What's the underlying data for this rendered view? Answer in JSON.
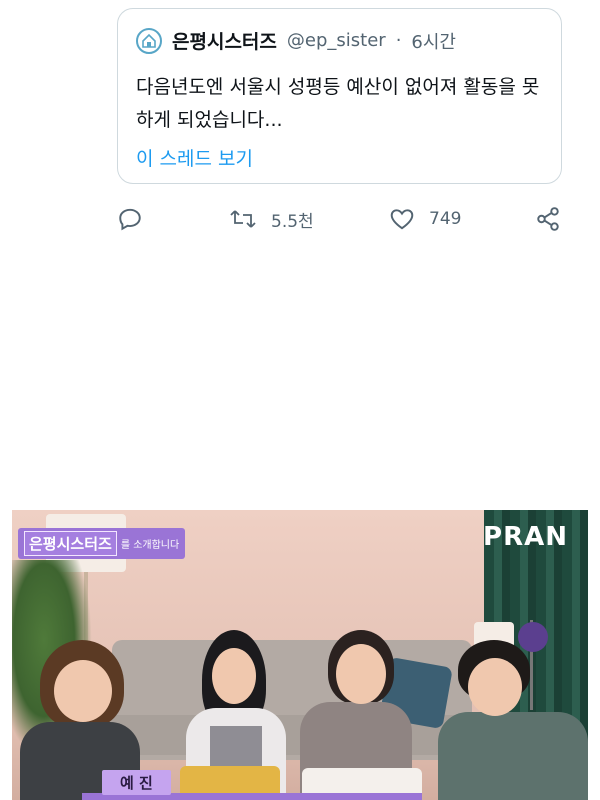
{
  "quoted_tweet": {
    "display_name": "은평시스터즈",
    "handle": "@ep_sister",
    "separator": "·",
    "time": "6시간",
    "text": "다음년도엔 서울시 성평등 예산이 없어져  활동을 못하게 되었습니다...",
    "thread_link": "이 스레드 보기"
  },
  "actions": {
    "reply_icon": "reply-icon",
    "retweet_count": "5.5천",
    "like_count": "749",
    "share_icon": "share-icon"
  },
  "video": {
    "channel_name": "은평시스터즈",
    "channel_subtitle": "를 소개합니다",
    "brand_logo": "PRAN",
    "speaker_caption": "예 진"
  },
  "colors": {
    "link": "#1d9bf0",
    "muted": "#536471",
    "border": "#cfd9de",
    "caption_purple": "#9a74d6"
  }
}
